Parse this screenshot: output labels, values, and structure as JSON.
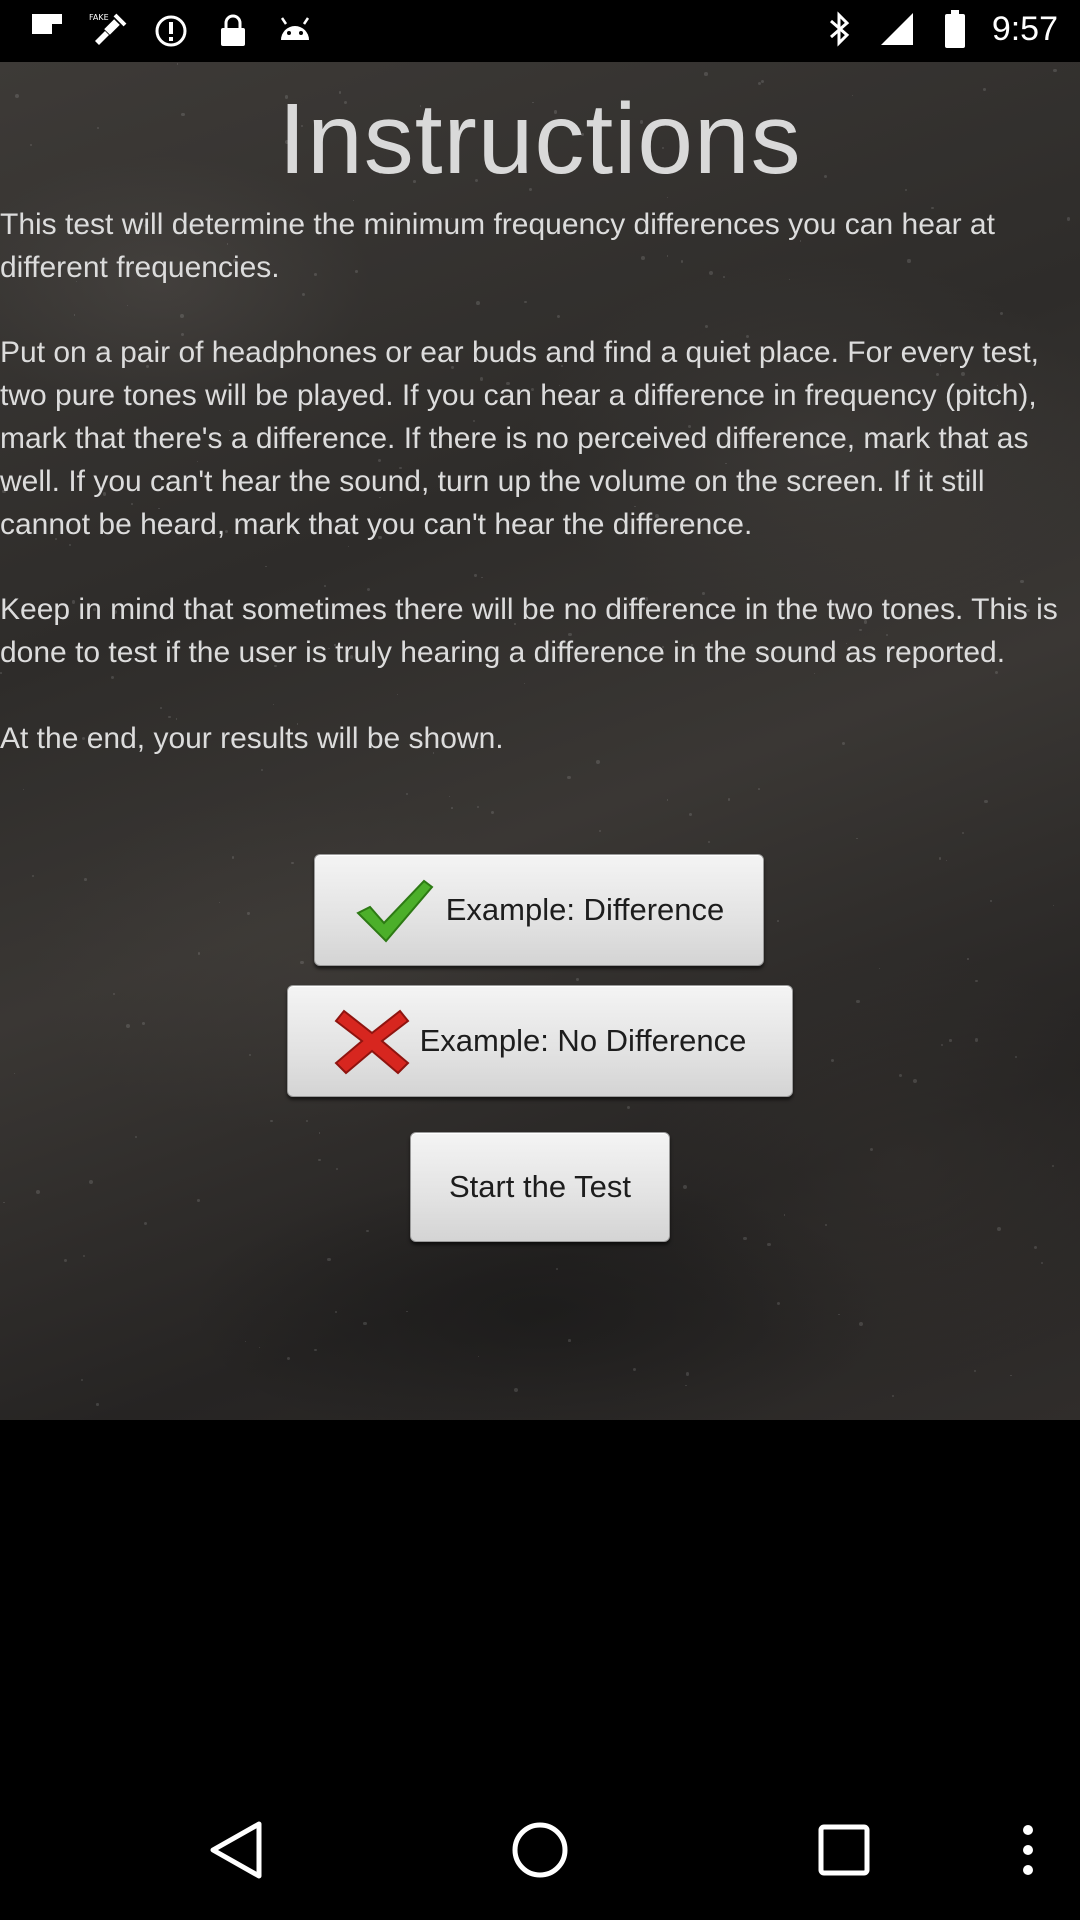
{
  "status_bar": {
    "time": "9:57",
    "left_icons": [
      "flipboard-icon",
      "fake-gps-icon",
      "alert-icon",
      "lock-icon",
      "android-icon"
    ],
    "right_icons": [
      "bluetooth-icon",
      "signal-icon",
      "battery-icon"
    ]
  },
  "app": {
    "title": "Instructions",
    "paragraphs": [
      "This test will determine the minimum frequency differences you can hear at different frequencies.",
      " Put on a pair of headphones or ear buds and find a quiet place. For every test, two pure tones will be played. If you can hear a difference in frequency (pitch), mark that there's a difference. If there is no perceived difference, mark that as well. If you can't hear the sound, turn up the volume on the screen. If it still cannot be heard, mark that you can't hear the difference.",
      " Keep in mind that sometimes there will be no difference in the two tones. This is done to test if the user is truly hearing a difference in the sound as reported.",
      " At the end, your results will be shown."
    ],
    "buttons": {
      "difference": "Example: Difference",
      "no_difference": "Example: No Difference",
      "start": "Start the Test"
    },
    "colors": {
      "check": "#4caf2a",
      "cross": "#d7261f"
    }
  },
  "nav_bar": {
    "buttons": [
      "back-icon",
      "home-icon",
      "recents-icon",
      "menu-icon"
    ]
  }
}
